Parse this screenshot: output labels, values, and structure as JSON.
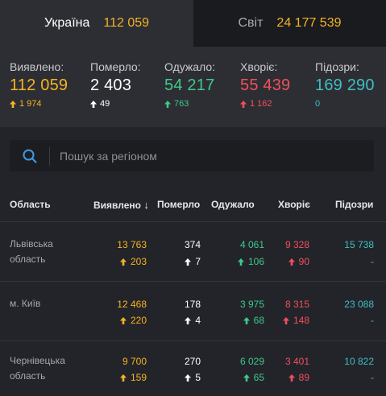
{
  "tabs": {
    "ukraine": {
      "label": "Україна",
      "count": "112 059"
    },
    "world": {
      "label": "Світ",
      "count": "24 177 539"
    }
  },
  "summary": {
    "detected": {
      "label": "Виявлено:",
      "value": "112 059",
      "delta": "1 974"
    },
    "died": {
      "label": "Померло:",
      "value": "2 403",
      "delta": "49"
    },
    "recovered": {
      "label": "Одужало:",
      "value": "54 217",
      "delta": "763"
    },
    "sick": {
      "label": "Хворіє:",
      "value": "55 439",
      "delta": "1 162"
    },
    "suspected": {
      "label": "Підозри:",
      "value": "169 290",
      "delta": "0"
    }
  },
  "search": {
    "placeholder": "Пошук за регіоном"
  },
  "table": {
    "headers": {
      "region": "Область",
      "detected": "Виявлено",
      "sort_arrow": "↓",
      "died": "Померло",
      "recovered": "Одужало",
      "sick": "Хворіє",
      "suspected": "Підозри"
    },
    "rows": [
      {
        "region": "Львівська область",
        "detected": "13 763",
        "detected_delta": "203",
        "died": "374",
        "died_delta": "7",
        "recovered": "4 061",
        "recovered_delta": "106",
        "sick": "9 328",
        "sick_delta": "90",
        "suspected": "15 738",
        "suspected_delta": "-"
      },
      {
        "region": "м. Київ",
        "detected": "12 468",
        "detected_delta": "220",
        "died": "178",
        "died_delta": "4",
        "recovered": "3 975",
        "recovered_delta": "68",
        "sick": "8 315",
        "sick_delta": "148",
        "suspected": "23 088",
        "suspected_delta": "-"
      },
      {
        "region": "Чернівецька область",
        "detected": "9 700",
        "detected_delta": "159",
        "died": "270",
        "died_delta": "5",
        "recovered": "6 029",
        "recovered_delta": "65",
        "sick": "3 401",
        "sick_delta": "89",
        "suspected": "10 822",
        "suspected_delta": "-"
      }
    ]
  },
  "colors": {
    "detected": "#f5b324",
    "died": "#ffffff",
    "recovered": "#3ec98b",
    "sick": "#f0505c",
    "suspected": "#3dbfc5"
  },
  "icons": {
    "search": "search-icon",
    "up_arrow": "arrow-up-icon"
  }
}
